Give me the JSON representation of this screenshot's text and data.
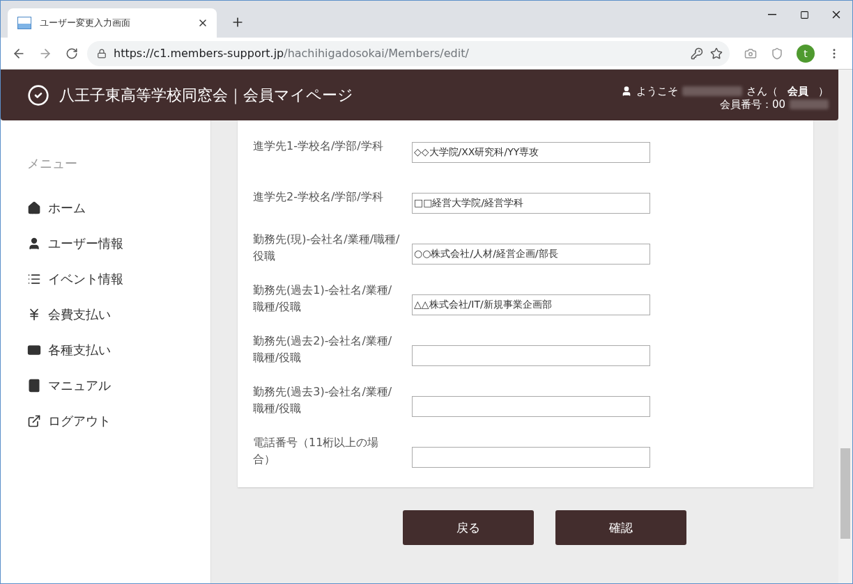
{
  "browser": {
    "tab_title": "ユーザー変更入力画面",
    "url_host": "https://c1.members-support.jp",
    "url_path": "/hachihigadosokai/Members/edit/",
    "profile_letter": "t"
  },
  "header": {
    "title": "八王子東高等学校同窓会｜会員マイページ",
    "welcome": "ようこそ",
    "honorific": "さん（",
    "role": "会員",
    "paren_close": "）",
    "member_no": "会員番号：00"
  },
  "sidebar": {
    "heading": "メニュー",
    "items": [
      {
        "kind": "home",
        "label": "ホーム"
      },
      {
        "kind": "user",
        "label": "ユーザー情報"
      },
      {
        "kind": "list",
        "label": "イベント情報"
      },
      {
        "kind": "yen",
        "label": "会費支払い"
      },
      {
        "kind": "card",
        "label": "各種支払い"
      },
      {
        "kind": "book",
        "label": "マニュアル"
      },
      {
        "kind": "logout",
        "label": "ログアウト"
      }
    ]
  },
  "form": {
    "fields": [
      {
        "label": "進学先1-学校名/学部/学科",
        "value": "◇◇大学院/XX研究科/YY専攻"
      },
      {
        "label": "進学先2-学校名/学部/学科",
        "value": "□□経営大学院/経営学科"
      },
      {
        "label": "勤務先(現)-会社名/業種/職種/役職",
        "value": "○○株式会社/人材/経営企画/部長"
      },
      {
        "label": "勤務先(過去1)-会社名/業種/職種/役職",
        "value": "△△株式会社/IT/新規事業企画部"
      },
      {
        "label": "勤務先(過去2)-会社名/業種/職種/役職"
      },
      {
        "label": "勤務先(過去3)-会社名/業種/職種/役職"
      },
      {
        "label": "電話番号（11桁以上の場合）"
      }
    ]
  },
  "buttons": [
    "戻る",
    "確認"
  ]
}
